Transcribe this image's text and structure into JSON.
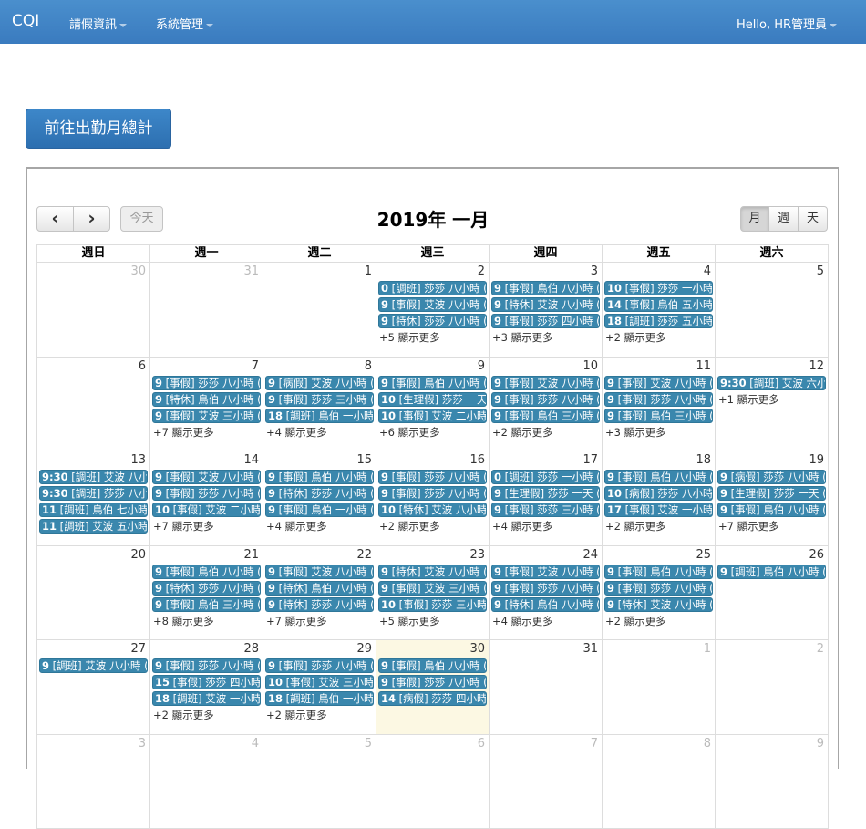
{
  "nav": {
    "brand": "CQI",
    "menu1": "請假資訊",
    "menu2": "系統管理",
    "user": "Hello, HR管理員"
  },
  "goto_button": "前往出勤月總計",
  "toolbar": {
    "prev": "‹",
    "next": "›",
    "today": "今天",
    "title": "2019年 一月",
    "view_month": "月",
    "view_week": "週",
    "view_day": "天"
  },
  "weekdays": [
    "週日",
    "週一",
    "週二",
    "週三",
    "週四",
    "週五",
    "週六"
  ],
  "today_cell": "2019-01-30",
  "weeks": [
    [
      {
        "d": "30",
        "other": true,
        "events": [],
        "more": ""
      },
      {
        "d": "31",
        "other": true,
        "events": [],
        "more": ""
      },
      {
        "d": "1",
        "events": [],
        "more": ""
      },
      {
        "d": "2",
        "events": [
          [
            "0",
            "[調班] 莎莎 八小時 ("
          ],
          [
            "9",
            "[事假] 艾波 八小時 ("
          ],
          [
            "9",
            "[特休] 莎莎 八小時 ("
          ]
        ],
        "more": "+5 顯示更多"
      },
      {
        "d": "3",
        "events": [
          [
            "9",
            "[事假] 鳥伯 八小時 ("
          ],
          [
            "9",
            "[特休] 艾波 八小時 ("
          ],
          [
            "9",
            "[事假] 莎莎 四小時 ("
          ]
        ],
        "more": "+3 顯示更多"
      },
      {
        "d": "4",
        "events": [
          [
            "10",
            "[事假] 莎莎 一小時"
          ],
          [
            "14",
            "[事假] 鳥伯 五小時"
          ],
          [
            "18",
            "[調班] 莎莎 五小時"
          ]
        ],
        "more": "+2 顯示更多"
      },
      {
        "d": "5",
        "events": [],
        "more": ""
      }
    ],
    [
      {
        "d": "6",
        "events": [],
        "more": ""
      },
      {
        "d": "7",
        "events": [
          [
            "9",
            "[事假] 莎莎 八小時 ("
          ],
          [
            "9",
            "[特休] 鳥伯 八小時 ("
          ],
          [
            "9",
            "[事假] 艾波 三小時 ("
          ]
        ],
        "more": "+7 顯示更多"
      },
      {
        "d": "8",
        "events": [
          [
            "9",
            "[病假] 艾波 八小時 ("
          ],
          [
            "9",
            "[事假] 莎莎 三小時 ("
          ],
          [
            "18",
            "[調班] 鳥伯 一小時"
          ]
        ],
        "more": "+4 顯示更多"
      },
      {
        "d": "9",
        "events": [
          [
            "9",
            "[事假] 鳥伯 八小時 ("
          ],
          [
            "10",
            "[生理假] 莎莎 一天"
          ],
          [
            "10",
            "[事假] 艾波 二小時"
          ]
        ],
        "more": "+6 顯示更多"
      },
      {
        "d": "10",
        "events": [
          [
            "9",
            "[事假] 艾波 八小時 ("
          ],
          [
            "9",
            "[事假] 莎莎 八小時 ("
          ],
          [
            "9",
            "[事假] 鳥伯 三小時 ("
          ]
        ],
        "more": "+2 顯示更多"
      },
      {
        "d": "11",
        "events": [
          [
            "9",
            "[事假] 艾波 八小時 ("
          ],
          [
            "9",
            "[事假] 莎莎 八小時 ("
          ],
          [
            "9",
            "[事假] 鳥伯 三小時 ("
          ]
        ],
        "more": "+3 顯示更多"
      },
      {
        "d": "12",
        "events": [
          [
            "9:30",
            "[調班] 艾波 六小時"
          ]
        ],
        "more": "+1 顯示更多"
      }
    ],
    [
      {
        "d": "13",
        "events": [
          [
            "9:30",
            "[調班] 艾波 八小時"
          ],
          [
            "9:30",
            "[調班] 莎莎 八小時"
          ],
          [
            "11",
            "[調班] 鳥伯 七小時"
          ],
          [
            "11",
            "[調班] 艾波 五小時"
          ]
        ],
        "more": ""
      },
      {
        "d": "14",
        "events": [
          [
            "9",
            "[事假] 艾波 八小時 ("
          ],
          [
            "9",
            "[事假] 莎莎 八小時 ("
          ],
          [
            "10",
            "[事假] 艾波 二小時"
          ]
        ],
        "more": "+7 顯示更多"
      },
      {
        "d": "15",
        "events": [
          [
            "9",
            "[事假] 鳥伯 八小時 ("
          ],
          [
            "9",
            "[特休] 莎莎 八小時 ("
          ],
          [
            "9",
            "[事假] 鳥伯 一小時 ("
          ]
        ],
        "more": "+4 顯示更多"
      },
      {
        "d": "16",
        "events": [
          [
            "9",
            "[事假] 莎莎 八小時 ("
          ],
          [
            "9",
            "[事假] 莎莎 八小時 ("
          ],
          [
            "10",
            "[特休] 艾波 八小時"
          ]
        ],
        "more": "+2 顯示更多"
      },
      {
        "d": "17",
        "events": [
          [
            "0",
            "[調班] 莎莎 一小時 ("
          ],
          [
            "9",
            "[生理假] 莎莎 一天 ("
          ],
          [
            "9",
            "[事假] 莎莎 三小時 ("
          ]
        ],
        "more": "+4 顯示更多"
      },
      {
        "d": "18",
        "events": [
          [
            "9",
            "[事假] 鳥伯 八小時 ("
          ],
          [
            "10",
            "[病假] 莎莎 八小時"
          ],
          [
            "17",
            "[事假] 艾波 一小時"
          ]
        ],
        "more": "+2 顯示更多"
      },
      {
        "d": "19",
        "events": [
          [
            "9",
            "[病假] 莎莎 八小時 ("
          ],
          [
            "9",
            "[生理假] 莎莎 一天 ("
          ],
          [
            "9",
            "[事假] 鳥伯 八小時 ("
          ]
        ],
        "more": "+7 顯示更多"
      }
    ],
    [
      {
        "d": "20",
        "events": [],
        "more": ""
      },
      {
        "d": "21",
        "events": [
          [
            "9",
            "[事假] 鳥伯 八小時 ("
          ],
          [
            "9",
            "[特休] 莎莎 八小時 ("
          ],
          [
            "9",
            "[事假] 鳥伯 三小時 ("
          ]
        ],
        "more": "+8 顯示更多"
      },
      {
        "d": "22",
        "events": [
          [
            "9",
            "[事假] 艾波 八小時 ("
          ],
          [
            "9",
            "[特休] 鳥伯 八小時 ("
          ],
          [
            "9",
            "[特休] 莎莎 八小時 ("
          ]
        ],
        "more": "+7 顯示更多"
      },
      {
        "d": "23",
        "events": [
          [
            "9",
            "[特休] 艾波 八小時 ("
          ],
          [
            "9",
            "[事假] 艾波 三小時 ("
          ],
          [
            "10",
            "[事假] 莎莎 三小時"
          ]
        ],
        "more": "+5 顯示更多"
      },
      {
        "d": "24",
        "events": [
          [
            "9",
            "[事假] 艾波 八小時 ("
          ],
          [
            "9",
            "[事假] 莎莎 八小時 ("
          ],
          [
            "9",
            "[特休] 鳥伯 八小時 ("
          ]
        ],
        "more": "+4 顯示更多"
      },
      {
        "d": "25",
        "events": [
          [
            "9",
            "[事假] 鳥伯 八小時 ("
          ],
          [
            "9",
            "[事假] 莎莎 八小時 ("
          ],
          [
            "9",
            "[特休] 艾波 八小時 ("
          ]
        ],
        "more": "+2 顯示更多"
      },
      {
        "d": "26",
        "events": [
          [
            "9",
            "[調班] 鳥伯 八小時 ("
          ]
        ],
        "more": ""
      }
    ],
    [
      {
        "d": "27",
        "events": [
          [
            "9",
            "[調班] 艾波 八小時 ("
          ]
        ],
        "more": ""
      },
      {
        "d": "28",
        "events": [
          [
            "9",
            "[事假] 莎莎 八小時 ("
          ],
          [
            "15",
            "[事假] 莎莎 四小時"
          ],
          [
            "18",
            "[調班] 艾波 一小時"
          ]
        ],
        "more": "+2 顯示更多"
      },
      {
        "d": "29",
        "events": [
          [
            "9",
            "[事假] 莎莎 八小時 ("
          ],
          [
            "10",
            "[事假] 艾波 三小時"
          ],
          [
            "18",
            "[調班] 鳥伯 一小時"
          ]
        ],
        "more": "+2 顯示更多"
      },
      {
        "d": "30",
        "today": true,
        "events": [
          [
            "9",
            "[事假] 鳥伯 八小時 ("
          ],
          [
            "9",
            "[事假] 莎莎 八小時 ("
          ],
          [
            "14",
            "[病假] 莎莎 四小時"
          ]
        ],
        "more": ""
      },
      {
        "d": "31",
        "events": [],
        "more": ""
      },
      {
        "d": "1",
        "other": true,
        "events": [],
        "more": ""
      },
      {
        "d": "2",
        "other": true,
        "events": [],
        "more": ""
      }
    ],
    [
      {
        "d": "3",
        "other": true,
        "events": [],
        "more": ""
      },
      {
        "d": "4",
        "other": true,
        "events": [],
        "more": ""
      },
      {
        "d": "5",
        "other": true,
        "events": [],
        "more": ""
      },
      {
        "d": "6",
        "other": true,
        "events": [],
        "more": ""
      },
      {
        "d": "7",
        "other": true,
        "events": [],
        "more": ""
      },
      {
        "d": "8",
        "other": true,
        "events": [],
        "more": ""
      },
      {
        "d": "9",
        "other": true,
        "events": [],
        "more": ""
      }
    ]
  ]
}
